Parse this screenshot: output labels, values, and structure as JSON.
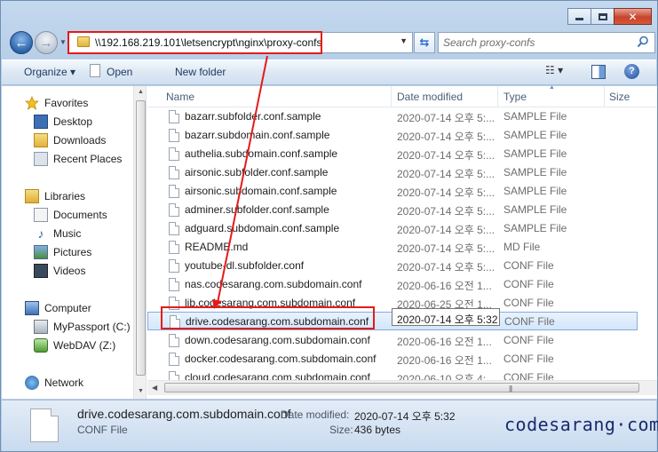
{
  "window": {
    "address": "\\\\192.168.219.101\\letsencrypt\\nginx\\proxy-confs",
    "search_placeholder": "Search proxy-confs"
  },
  "toolbar": {
    "organize": "Organize ▾",
    "open": "Open",
    "new_folder": "New folder"
  },
  "nav_pane": {
    "favorites": {
      "label": "Favorites",
      "items": [
        "Desktop",
        "Downloads",
        "Recent Places"
      ]
    },
    "libraries": {
      "label": "Libraries",
      "items": [
        "Documents",
        "Music",
        "Pictures",
        "Videos"
      ]
    },
    "computer": {
      "label": "Computer",
      "items": [
        "MyPassport (C:)",
        "WebDAV (Z:)"
      ]
    },
    "network": {
      "label": "Network"
    }
  },
  "columns": {
    "name": "Name",
    "date": "Date modified",
    "type": "Type",
    "size": "Size"
  },
  "files": [
    {
      "name": "bazarr.subfolder.conf.sample",
      "date": "2020-07-14 오후 5:...",
      "type": "SAMPLE File"
    },
    {
      "name": "bazarr.subdomain.conf.sample",
      "date": "2020-07-14 오후 5:...",
      "type": "SAMPLE File"
    },
    {
      "name": "authelia.subdomain.conf.sample",
      "date": "2020-07-14 오후 5:...",
      "type": "SAMPLE File"
    },
    {
      "name": "airsonic.subfolder.conf.sample",
      "date": "2020-07-14 오후 5:...",
      "type": "SAMPLE File"
    },
    {
      "name": "airsonic.subdomain.conf.sample",
      "date": "2020-07-14 오후 5:...",
      "type": "SAMPLE File"
    },
    {
      "name": "adminer.subfolder.conf.sample",
      "date": "2020-07-14 오후 5:...",
      "type": "SAMPLE File"
    },
    {
      "name": "adguard.subdomain.conf.sample",
      "date": "2020-07-14 오후 5:...",
      "type": "SAMPLE File"
    },
    {
      "name": "README.md",
      "date": "2020-07-14 오후 5:...",
      "type": "MD File"
    },
    {
      "name": "youtube-dl.subfolder.conf",
      "date": "2020-07-14 오후 5:...",
      "type": "CONF File"
    },
    {
      "name": "nas.codesarang.com.subdomain.conf",
      "date": "2020-06-16 오전 1...",
      "type": "CONF File"
    },
    {
      "name": "lib.codesarang.com.subdomain.conf",
      "date": "2020-06-25 오전 1...",
      "type": "CONF File"
    },
    {
      "name": "drive.codesarang.com.subdomain.conf",
      "date": "",
      "type": "CONF File"
    },
    {
      "name": "down.codesarang.com.subdomain.conf",
      "date": "2020-06-16 오전 1...",
      "type": "CONF File"
    },
    {
      "name": "docker.codesarang.com.subdomain.conf",
      "date": "2020-06-16 오전 1...",
      "type": "CONF File"
    },
    {
      "name": "cloud.codesarang.com.subdomain.conf",
      "date": "2020-06-10 오후 4:...",
      "type": "CONF File"
    }
  ],
  "selected_tooltip": "2020-07-14 오후 5:32",
  "details": {
    "name": "drive.codesarang.com.subdomain.conf",
    "type": "CONF File",
    "date_label": "Date modified:",
    "date_value": "2020-07-14 오후 5:32",
    "size_label": "Size:",
    "size_value": "436 bytes"
  },
  "watermark": "codesarang·com",
  "colors": {
    "highlight": "#e41b1b",
    "selection": "#d3e6fa",
    "accent": "#2b62a8"
  }
}
